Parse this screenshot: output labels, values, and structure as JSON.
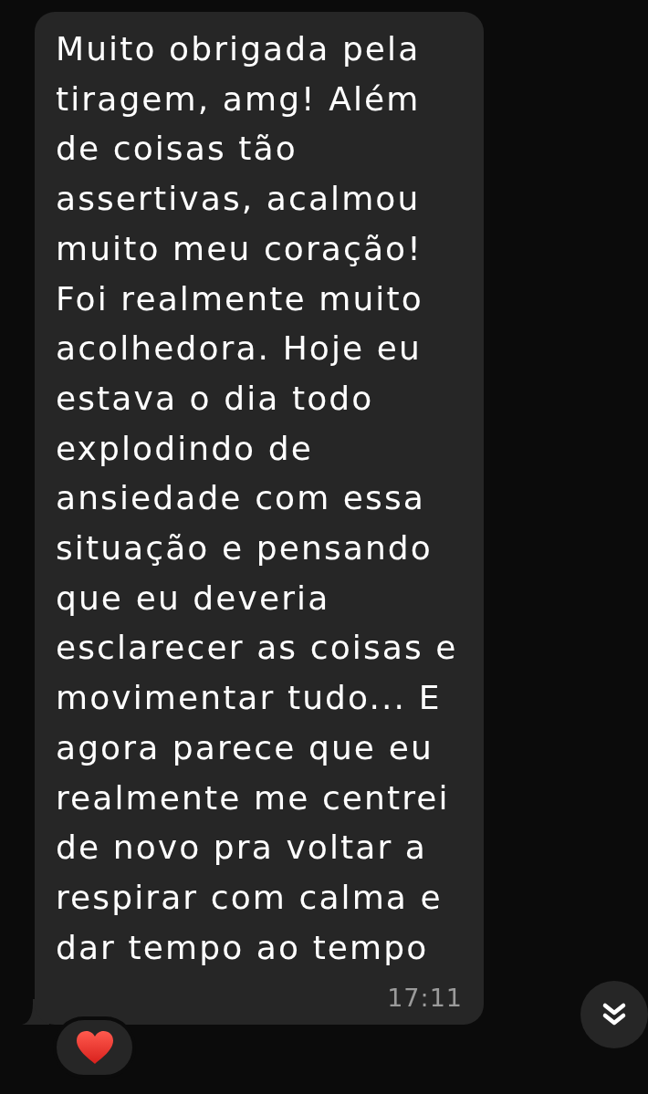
{
  "messages": [
    {
      "kind": "received",
      "text": "Muito obrigada pela tiragem, amg! Além de coisas tão assertivas, acalmou muito meu coração! Foi realmente muito acolhedora. Hoje eu estava o dia todo explodindo de ansiedade com essa situação e pensando que eu deveria esclarecer as coisas e movimentar tudo... E agora parece que eu realmente me centrei de novo pra voltar a respirar com calma e dar tempo ao tempo",
      "time": "17:11",
      "reactions": [
        {
          "kind": "heart"
        }
      ]
    }
  ]
}
